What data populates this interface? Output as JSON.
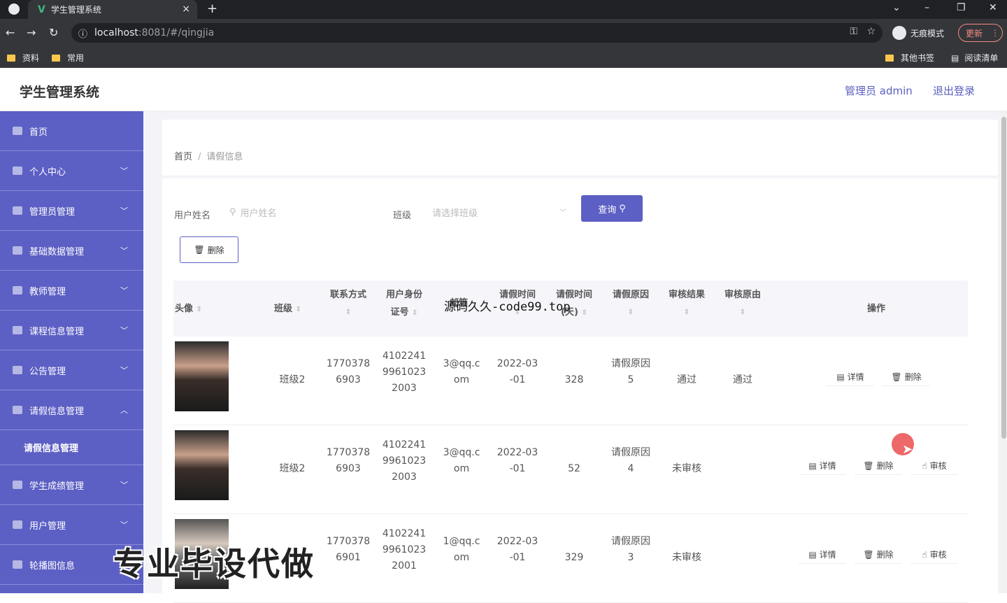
{
  "browser": {
    "tab_title": "学生管理系统",
    "tab_close": "×",
    "new_tab": "+",
    "url_host": "localhost",
    "url_path": ":8081/#/qingjia",
    "incognito_label": "无痕模式",
    "update_label": "更新",
    "bookmarks": [
      "资料",
      "常用"
    ],
    "other_bookmarks": "其他书签",
    "reading_list": "阅读清单"
  },
  "header": {
    "title": "学生管理系统",
    "admin": "管理员 admin",
    "logout": "退出登录"
  },
  "sidebar": {
    "items": [
      {
        "label": "首页"
      },
      {
        "label": "个人中心"
      },
      {
        "label": "管理员管理"
      },
      {
        "label": "基础数据管理"
      },
      {
        "label": "教师管理"
      },
      {
        "label": "课程信息管理"
      },
      {
        "label": "公告管理"
      },
      {
        "label": "请假信息管理"
      },
      {
        "label": "学生成绩管理"
      },
      {
        "label": "用户管理"
      },
      {
        "label": "轮播图信息"
      }
    ],
    "sub_item": "请假信息管理"
  },
  "breadcrumb": {
    "home": "首页",
    "sep": "/",
    "current": "请假信息"
  },
  "search": {
    "name_label": "用户姓名",
    "name_placeholder": "用户姓名",
    "class_label": "班级",
    "class_placeholder": "请选择班级",
    "query_button": "查询",
    "delete_button": "删除"
  },
  "table": {
    "headers": {
      "avatar": "头像",
      "class": "班级",
      "contact1": "联系方式",
      "idcard1": "用户身份",
      "idcard2": "证号",
      "email": "邮箱",
      "time1": "请假时间",
      "days1": "请假时间",
      "days2": "(天)",
      "reason": "请假原因",
      "result": "审核结果",
      "why": "审核原由",
      "op": "操作"
    },
    "rows": [
      {
        "class": "班级2",
        "phone1": "1770378",
        "phone2": "6903",
        "id1": "4102241",
        "id2": "9961023",
        "id3": "2003",
        "email1": "3@qq.c",
        "email2": "om",
        "date1": "2022-03",
        "date2": "-01",
        "days": "328",
        "reason1": "请假原因",
        "reason2": "5",
        "result": "通过",
        "why": "通过",
        "ops": [
          "详情",
          "删除"
        ]
      },
      {
        "class": "班级2",
        "phone1": "1770378",
        "phone2": "6903",
        "id1": "4102241",
        "id2": "9961023",
        "id3": "2003",
        "email1": "3@qq.c",
        "email2": "om",
        "date1": "2022-03",
        "date2": "-01",
        "days": "52",
        "reason1": "请假原因",
        "reason2": "4",
        "result": "未审核",
        "why": "",
        "ops": [
          "详情",
          "删除",
          "审核"
        ]
      },
      {
        "class": "",
        "phone1": "1770378",
        "phone2": "6901",
        "id1": "4102241",
        "id2": "9961023",
        "id3": "2001",
        "email1": "1@qq.c",
        "email2": "om",
        "date1": "2022-03",
        "date2": "-01",
        "days": "329",
        "reason1": "请假原因",
        "reason2": "3",
        "result": "未审核",
        "why": "",
        "ops": [
          "详情",
          "删除",
          "审核"
        ]
      }
    ]
  },
  "overlays": {
    "code_mark": "源码久久-code99.top",
    "promo": "专业毕设代做"
  }
}
